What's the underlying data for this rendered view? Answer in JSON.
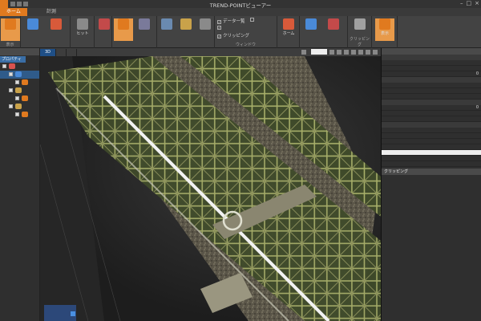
{
  "window": {
    "title": "TREND-POINTビューアー",
    "controls": [
      "–",
      "□",
      "×"
    ]
  },
  "menu_tabs": [
    {
      "label": "ホーム",
      "active": true
    },
    {
      "label": "",
      "active": false
    },
    {
      "label": "計測",
      "active": false
    },
    {
      "label": "",
      "active": false
    },
    {
      "label": "",
      "active": false
    },
    {
      "label": "",
      "active": false
    },
    {
      "label": "",
      "active": false
    }
  ],
  "ribbon": {
    "groups": [
      {
        "label": "表示"
      },
      {
        "label": ""
      },
      {
        "label": ""
      },
      {
        "label": ""
      },
      {
        "label": ""
      },
      {
        "label": ""
      },
      {
        "label": "ウィンドウ"
      },
      {
        "label": ""
      },
      {
        "label": ""
      },
      {
        "label": "クリッピング"
      },
      {
        "label": ""
      }
    ],
    "buttons": [
      {
        "label": "",
        "color": "#e07a1f"
      },
      {
        "label": "",
        "color": "#4a8ad8"
      },
      {
        "label": "",
        "color": "#d85a3a"
      },
      {
        "label": "",
        "color": "#c9a24a"
      },
      {
        "label": "ヒット",
        "color": "#8a8a8a"
      },
      {
        "label": "",
        "color": "#c34a4a"
      },
      {
        "label": "",
        "color": "#e07a1f"
      },
      {
        "label": "",
        "color": "#7a7a9a"
      },
      {
        "label": "",
        "color": "#6a8ab0"
      },
      {
        "label": "",
        "color": "#c9a24a"
      },
      {
        "label": "",
        "color": "#8a8a8a"
      },
      {
        "label": "ホーム",
        "color": "#d85a3a"
      },
      {
        "label": "",
        "color": "#4a8ad8"
      },
      {
        "label": "",
        "color": "#c34a4a"
      },
      {
        "label": "",
        "color": "#a0a0a0"
      },
      {
        "label": "表示",
        "color": "#e07a1f"
      }
    ],
    "checks": [
      {
        "label": "データ一覧",
        "checked": true
      },
      {
        "label": "",
        "checked": false
      },
      {
        "label": "",
        "checked": true
      },
      {
        "label": "クリッピング",
        "checked": true
      }
    ]
  },
  "left_panel": {
    "title": "",
    "tab": "プロパティ",
    "rows": [
      {
        "level": 0,
        "icon_color": "#d9534f",
        "selected": false,
        "label": ""
      },
      {
        "level": 1,
        "icon_color": "#4a8ad8",
        "selected": true,
        "label": ""
      },
      {
        "level": 2,
        "icon_color": "#e07a1f",
        "selected": false,
        "label": ""
      },
      {
        "level": 1,
        "icon_color": "#c9a24a",
        "selected": false,
        "label": ""
      },
      {
        "level": 2,
        "icon_color": "#e07a1f",
        "selected": false,
        "label": ""
      },
      {
        "level": 1,
        "icon_color": "#c9a24a",
        "selected": false,
        "label": ""
      },
      {
        "level": 2,
        "icon_color": "#e07a1f",
        "selected": false,
        "label": ""
      }
    ]
  },
  "viewport": {
    "tabs": [
      {
        "label": "3D",
        "active": true
      },
      {
        "label": "",
        "active": false
      },
      {
        "label": "",
        "active": false
      }
    ],
    "tool_label": "",
    "value": ""
  },
  "right_panel": {
    "title": "",
    "groups": [
      {
        "title": "",
        "props": [
          {
            "k": "",
            "v": ""
          },
          {
            "k": "",
            "v": ""
          },
          {
            "k": "",
            "v": "0"
          }
        ]
      },
      {
        "title": "",
        "props": [
          {
            "k": "",
            "v": ""
          },
          {
            "k": "",
            "v": ""
          },
          {
            "k": "",
            "v": ""
          }
        ]
      },
      {
        "title": "",
        "props": [
          {
            "k": "",
            "v": "0"
          },
          {
            "k": "",
            "v": ""
          },
          {
            "k": "",
            "v": ""
          }
        ]
      },
      {
        "title": "",
        "props": [
          {
            "k": "",
            "v": ""
          },
          {
            "k": "",
            "v": ""
          },
          {
            "k": "",
            "v": ""
          },
          {
            "k": "",
            "v": ""
          },
          {
            "k": "",
            "v": "",
            "sel": true
          },
          {
            "k": "",
            "v": ""
          },
          {
            "k": "",
            "v": ""
          }
        ]
      }
    ],
    "clipping": {
      "title": "クリッピング",
      "button": ""
    }
  }
}
